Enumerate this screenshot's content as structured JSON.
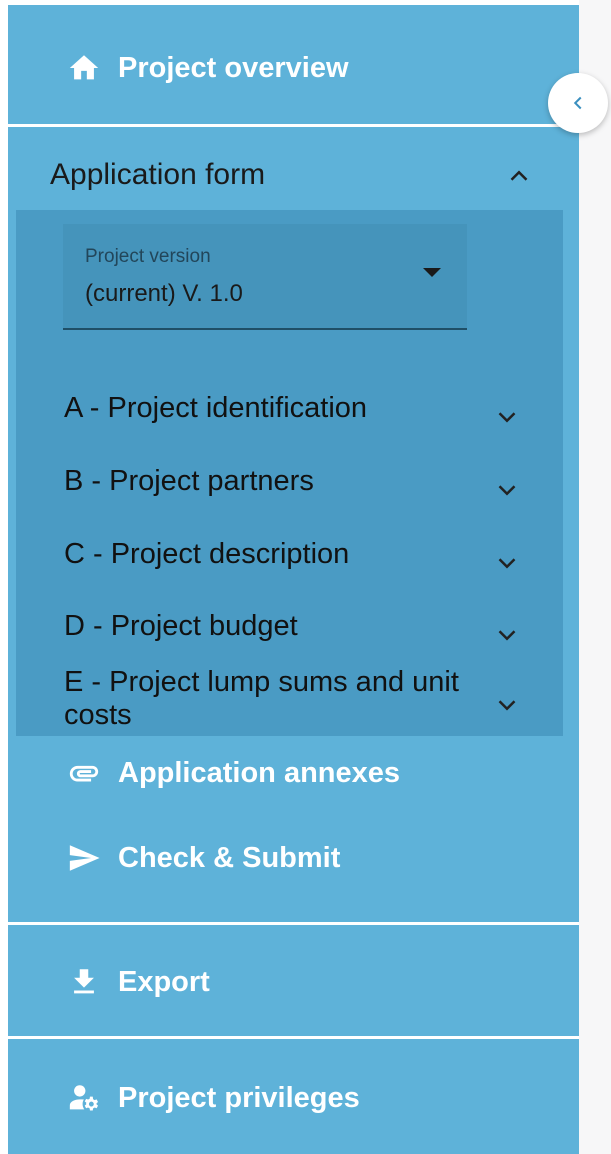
{
  "sidebar": {
    "project_overview": {
      "label": "Project overview",
      "icon": "home-icon"
    },
    "application_form": {
      "label": "Application form",
      "expanded": true,
      "version_select": {
        "caption": "Project version",
        "value": "(current) V. 1.0"
      },
      "sections": [
        {
          "label": "A - Project identification"
        },
        {
          "label": "B - Project partners"
        },
        {
          "label": "C - Project description"
        },
        {
          "label": "D - Project budget"
        },
        {
          "label": "E - Project lump sums and unit costs"
        }
      ]
    },
    "application_annexes": {
      "label": "Application annexes",
      "icon": "paperclip-icon"
    },
    "check_submit": {
      "label": "Check & Submit",
      "icon": "send-icon"
    },
    "export": {
      "label": "Export",
      "icon": "download-icon"
    },
    "project_privileges": {
      "label": "Project privileges",
      "icon": "user-settings-icon"
    }
  },
  "collapse_button": {
    "icon": "chevron-left-icon"
  },
  "colors": {
    "sidebar_bg": "#5eb2d9",
    "subpanel_bg": "#4a9bc4",
    "text_light": "#ffffff",
    "text_dark": "#111111"
  }
}
